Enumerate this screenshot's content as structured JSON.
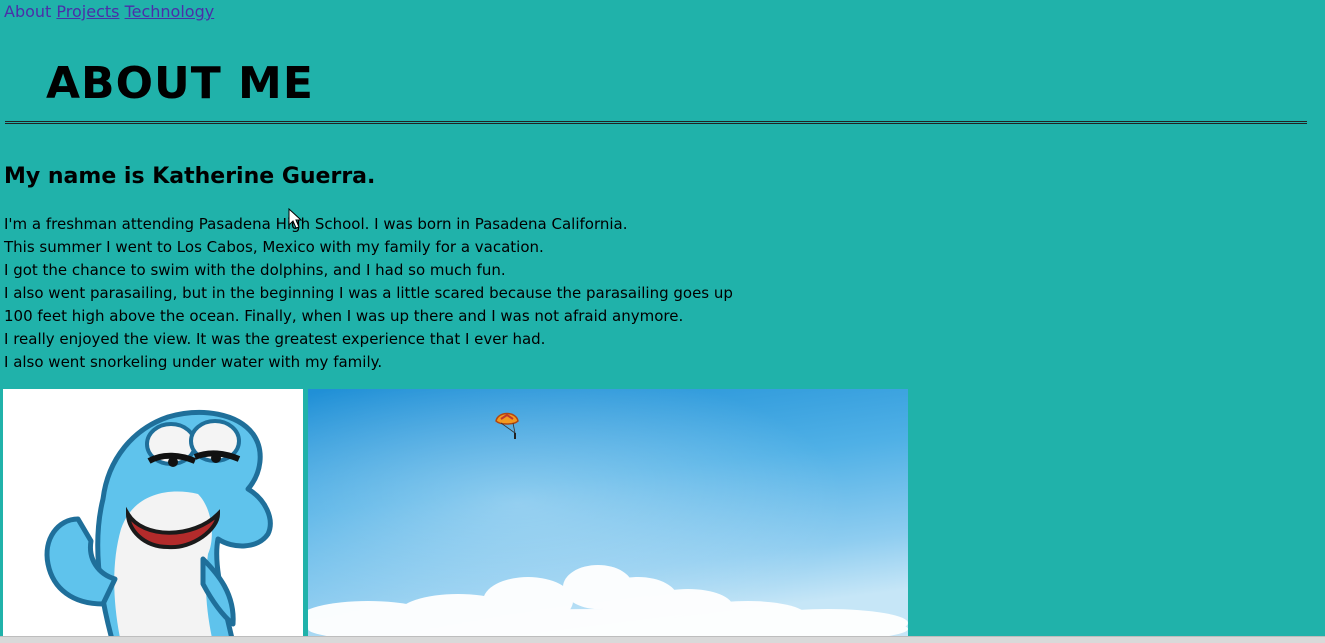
{
  "nav": {
    "about": "About",
    "projects": "Projects",
    "technology": "Technology"
  },
  "heading": "ABOUT ME",
  "subheading": "My name is Katherine Guerra.",
  "bio_lines": [
    "I'm a freshman attending Pasadena High School. I was born in Pasadena California.",
    "This summer I went to Los Cabos, Mexico with my family for a vacation.",
    "I got the chance to swim with the dolphins, and I had so much fun.",
    "I also went parasailing, but in the beginning I was a little scared because the parasailing goes up",
    "100 feet high above the ocean. Finally, when I was up there and I was not afraid anymore.",
    "I really enjoyed the view. It was the greatest experience that I ever had.",
    "I also went snorkeling under water with my family."
  ],
  "colors": {
    "background": "#20b2aa",
    "link": "#4b2fa8"
  },
  "icons": {
    "cursor": "arrow-cursor-icon"
  }
}
